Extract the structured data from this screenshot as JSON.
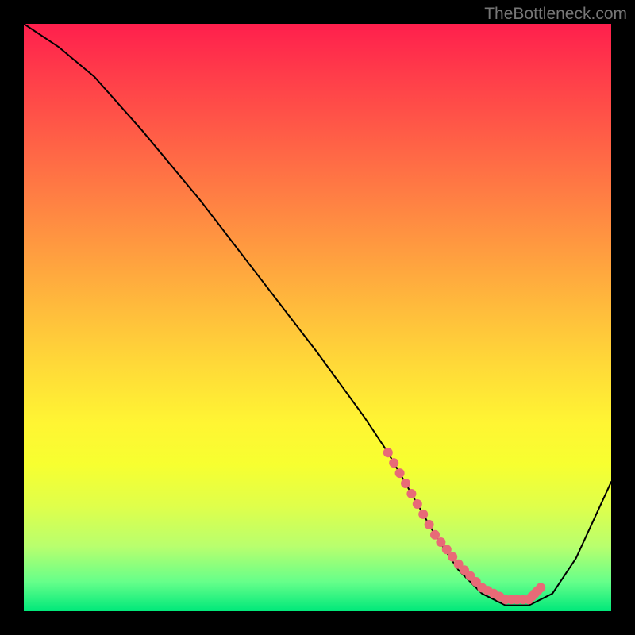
{
  "watermark": "TheBottleneck.com",
  "chart_data": {
    "type": "line",
    "title": "",
    "xlabel": "",
    "ylabel": "",
    "xlim": [
      0,
      100
    ],
    "ylim": [
      0,
      100
    ],
    "series": [
      {
        "name": "bottleneck-curve",
        "x": [
          0,
          6,
          12,
          20,
          30,
          40,
          50,
          58,
          62,
          66,
          70,
          74,
          78,
          82,
          86,
          90,
          94,
          100
        ],
        "y": [
          100,
          96,
          91,
          82,
          70,
          57,
          44,
          33,
          27,
          20,
          13,
          7,
          3,
          1,
          1,
          3,
          9,
          22
        ],
        "estimated": true
      }
    ],
    "highlight": {
      "name": "marker-band",
      "note": "pink dotted segment near curve minimum",
      "x": [
        62,
        66,
        70,
        74,
        78,
        82,
        86,
        88
      ],
      "y": [
        27,
        20,
        13,
        8,
        4,
        2,
        2,
        4
      ],
      "estimated": true
    },
    "colors": {
      "curve": "#000000",
      "markers": "#e86a77",
      "gradient_top": "#ff1f4d",
      "gradient_bottom": "#00e87a"
    }
  }
}
